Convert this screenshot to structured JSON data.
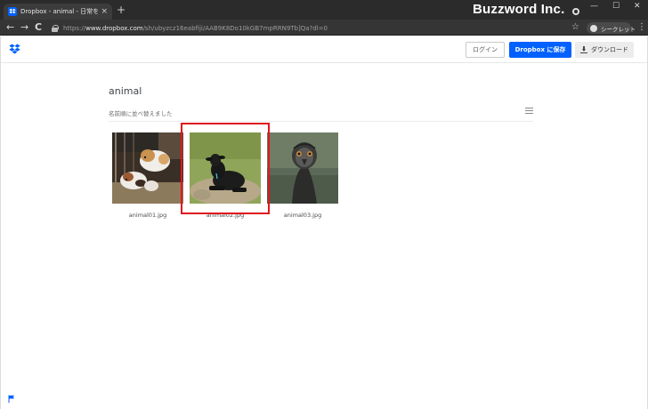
{
  "window": {
    "tab_title": "Dropbox - animal - 日常をシンプル",
    "tab_close": "×",
    "new_tab": "+",
    "brand_watermark": "Buzzword Inc.",
    "minimize": "—",
    "maximize": "☐",
    "close": "✕"
  },
  "toolbar": {
    "back": "←",
    "forward": "→",
    "reload": "C",
    "url_scheme": "https://",
    "url_host": "www.dropbox.com",
    "url_path": "/sh/ubyzcz16eabfiji/AAB9K8Do10kGB7mpRRN9Tb]Qa?dl=0",
    "star": "☆",
    "incognito_label": "シークレット",
    "menu": "⋮"
  },
  "header": {
    "login_label": "ログイン",
    "save_label": "Dropbox に保存",
    "download_label": "ダウンロード"
  },
  "folder": {
    "title": "animal",
    "sort_label": "名前順に並べ替えました",
    "files": [
      {
        "name": "animal01.jpg",
        "thumb": "guinea pigs in hutch"
      },
      {
        "name": "animal02.jpg",
        "thumb": "black goat on grass",
        "selected": true
      },
      {
        "name": "animal03.jpg",
        "thumb": "emu face"
      }
    ]
  },
  "colors": {
    "dropbox_blue": "#0061fe",
    "highlight_red": "#e0181d",
    "chrome_dark": "#2b2b2b"
  }
}
